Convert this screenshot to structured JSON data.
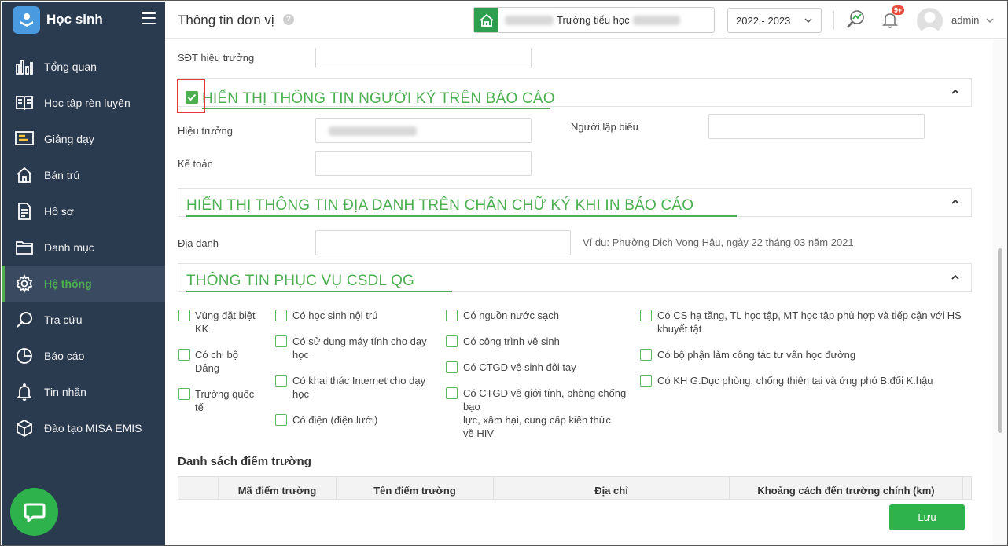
{
  "app": {
    "title": "Học sinh",
    "brand_color": "#2a3a4f",
    "accent_color": "#4caf50"
  },
  "sidebar": {
    "items": [
      {
        "label": "Tổng quan",
        "icon": "bar-chart-icon"
      },
      {
        "label": "Học tập rèn luyện",
        "icon": "book-icon"
      },
      {
        "label": "Giảng dạy",
        "icon": "board-icon"
      },
      {
        "label": "Bán trú",
        "icon": "house-icon"
      },
      {
        "label": "Hồ sơ",
        "icon": "document-icon"
      },
      {
        "label": "Danh mục",
        "icon": "folder-icon"
      },
      {
        "label": "Hệ thống",
        "icon": "gear-icon",
        "active": true
      },
      {
        "label": "Tra cứu",
        "icon": "search-icon"
      },
      {
        "label": "Báo cáo",
        "icon": "pie-chart-icon"
      },
      {
        "label": "Tin nhắn",
        "icon": "bell-icon"
      },
      {
        "label": "Đào tạo MISA EMIS",
        "icon": "cube-icon"
      }
    ]
  },
  "header": {
    "page_title": "Thông tin đơn vị",
    "help": "?",
    "school_name": "Trường tiểu học",
    "school_year": "2022 - 2023",
    "notification_badge": "9+",
    "user": "admin"
  },
  "form": {
    "principal_phone_label": "SĐT hiệu trưởng",
    "signer_section": {
      "title": "HIỂN THỊ THÔNG TIN NGƯỜI KÝ TRÊN BÁO CÁO",
      "checked": true,
      "principal_label": "Hiệu trưởng",
      "preparer_label": "Người lập biểu",
      "accountant_label": "Kế toán"
    },
    "place_section": {
      "title": "HIỂN THỊ THÔNG TIN ĐỊA DANH TRÊN CHÂN CHỮ KÝ KHI IN BÁO CÁO",
      "place_label": "Địa danh",
      "place_hint": "Ví dụ: Phường Dịch Vong Hậu, ngày 22 tháng 03 năm 2021"
    },
    "csdl_section": {
      "title": "THÔNG TIN PHỤC VỤ CSDL QG",
      "col1": [
        {
          "l1": "Vùng đặt biệt",
          "l2": "KK"
        },
        {
          "l1": "Có chi bộ",
          "l2": "Đảng"
        },
        {
          "l1": "Trường quốc",
          "l2": "tế"
        }
      ],
      "col2": [
        {
          "l1": "Có học sinh nội trú",
          "l2": ""
        },
        {
          "l1": "Có sử dụng máy tính cho dạy",
          "l2": "học"
        },
        {
          "l1": "Có khai thác Internet cho dạy",
          "l2": "học"
        },
        {
          "l1": "Có điện (điện lưới)",
          "l2": ""
        }
      ],
      "col3": [
        {
          "l1": "Có nguồn nước sạch"
        },
        {
          "l1": "Có công trình vệ sinh"
        },
        {
          "l1": "Có CTGD vệ sinh đôi tay"
        },
        {
          "l1": "Có CTGD về giới tính, phòng chống",
          "l2": "bạo",
          "l3": "lực, xâm hại, cung cấp kiến thức",
          "l4": "về HIV"
        }
      ],
      "col4": [
        {
          "l1": "Có CS hạ tầng, TL học tập, MT học tập phù hợp và tiếp cận với HS",
          "l2": "khuyết tật"
        },
        {
          "l1": "Có bộ phận làm công tác tư vấn học đường",
          "l2": ""
        },
        {
          "l1": "Có KH G.Dục phòng, chống thiên tai và ứng phó B.đổi K.hậu",
          "l2": ""
        }
      ]
    },
    "branch_list": {
      "title": "Danh sách điểm trường",
      "columns": [
        "",
        "Mã điểm trường",
        "Tên điểm trường",
        "Địa chỉ",
        "Khoảng cách đến trường chính (km)"
      ]
    },
    "save_label": "Lưu"
  }
}
